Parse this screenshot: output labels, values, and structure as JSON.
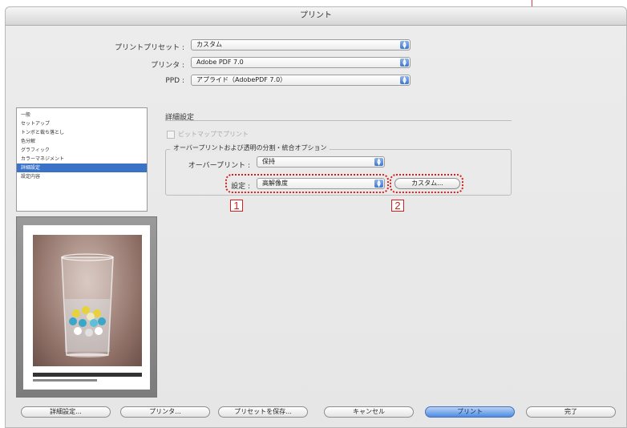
{
  "window": {
    "title": "プリント"
  },
  "header": {
    "preset_label": "プリントプリセット :",
    "preset_value": "カスタム",
    "printer_label": "プリンタ :",
    "printer_value": "Adobe PDF 7.0",
    "ppd_label": "PPD :",
    "ppd_value": "アプライド（AdobePDF 7.0）"
  },
  "sidebar": {
    "items": [
      {
        "label": "一般",
        "selected": false
      },
      {
        "label": "セットアップ",
        "selected": false
      },
      {
        "label": "トンボと裁ち落とし",
        "selected": false
      },
      {
        "label": "色分解",
        "selected": false
      },
      {
        "label": "グラフィック",
        "selected": false
      },
      {
        "label": "カラーマネジメント",
        "selected": false
      },
      {
        "label": "詳細設定",
        "selected": true
      },
      {
        "label": "設定内容",
        "selected": false
      }
    ]
  },
  "main": {
    "section_title": "詳細設定",
    "bitmap_checkbox_label": "ビットマップでプリント",
    "group_title": "オーバープリントおよび透明の分割・統合オプション",
    "overprint_label": "オーバープリント :",
    "overprint_value": "保持",
    "preset_label": "設定 :",
    "preset_value": "高解像度",
    "custom_button": "カスタム..."
  },
  "annotations": {
    "badge1": "1",
    "badge2": "2",
    "color": "#d02020"
  },
  "footer": {
    "setup_button": "詳細設定...",
    "printer_button": "プリンタ...",
    "save_preset_button": "プリセットを保存...",
    "cancel_button": "キャンセル",
    "print_button": "プリント",
    "done_button": "完了"
  },
  "colors": {
    "accent": "#3a72c8",
    "dialog_bg": "#e8e8e8"
  }
}
